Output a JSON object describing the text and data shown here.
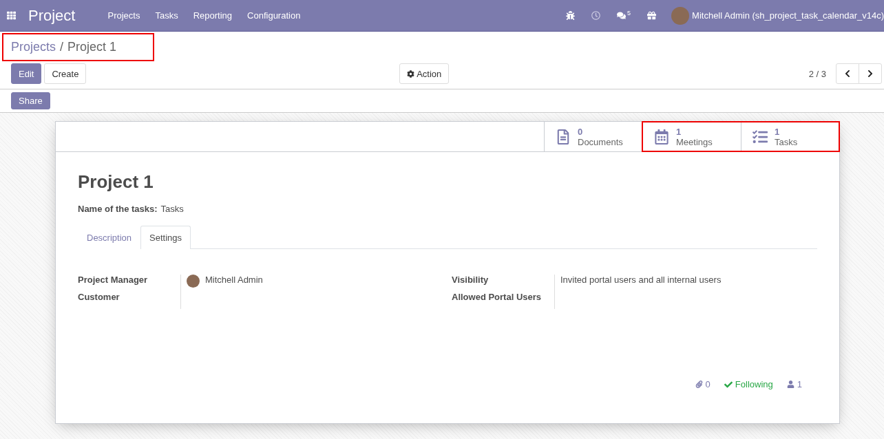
{
  "navbar": {
    "app_name": "Project",
    "menu": [
      "Projects",
      "Tasks",
      "Reporting",
      "Configuration"
    ],
    "messages_count": "5",
    "user": "Mitchell Admin (sh_project_task_calendar_v14c)"
  },
  "breadcrumb": {
    "highlighted": true,
    "items": [
      "Projects",
      "Project 1"
    ],
    "separator": "/"
  },
  "buttons": {
    "edit": "Edit",
    "create": "Create",
    "action": "Action",
    "share": "Share"
  },
  "pager": "2 / 3",
  "stat_groups": [
    {
      "highlighted": false,
      "buttons": [
        {
          "kind": "document",
          "count": "0",
          "label": "Documents"
        }
      ]
    },
    {
      "highlighted": true,
      "buttons": [
        {
          "kind": "calendar",
          "count": "1",
          "label": "Meetings"
        },
        {
          "kind": "tasks",
          "count": "1",
          "label": "Tasks"
        }
      ]
    }
  ],
  "title": "Project 1",
  "task_name": {
    "label": "Name of the tasks:",
    "value": "Tasks"
  },
  "tabs": [
    {
      "label": "Description",
      "selected": false
    },
    {
      "label": "Settings",
      "selected": true
    }
  ],
  "fields_left": [
    {
      "label": "Project Manager",
      "value": "Mitchell Admin",
      "avatar": true
    },
    {
      "label": "Customer"
    }
  ],
  "fields_right": [
    {
      "label": "Visibility",
      "value": "Invited portal users and all internal users"
    },
    {
      "label": "Allowed Portal Users"
    }
  ],
  "chatter": {
    "attachments": "0",
    "following": "Following",
    "followers": "1"
  }
}
